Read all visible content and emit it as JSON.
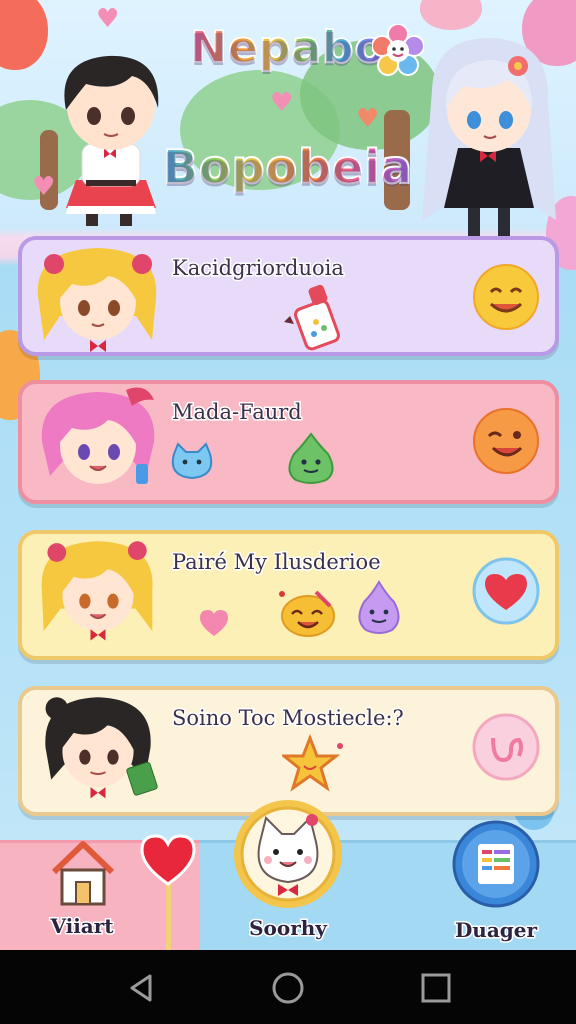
{
  "header": {
    "title_line1": "Nepabo",
    "title_line2": "Bopobeia"
  },
  "cards": [
    {
      "label": "Kacidgriorduoia",
      "action_icon": "smiley-face-icon"
    },
    {
      "label": "Mada-Faurd",
      "action_icon": "winking-face-icon"
    },
    {
      "label": "Pairé My Ilusderioe",
      "action_icon": "heart-bubble-icon"
    },
    {
      "label": "Soino Toc Mostiecle:?",
      "action_icon": "swirl-bubble-icon"
    }
  ],
  "nav": {
    "left_label": "Viiart",
    "center_label": "Soorhy",
    "right_label": "Duager"
  },
  "colors": {
    "card1_bg": "#e7dbf9",
    "card2_bg": "#f8b9c4",
    "card3_bg": "#fdf0b6",
    "card4_bg": "#fdf3da",
    "nav_left_bg": "#f7b3c0",
    "nav_right_bg": "#a4d9f3",
    "system_bar": "#050505"
  }
}
